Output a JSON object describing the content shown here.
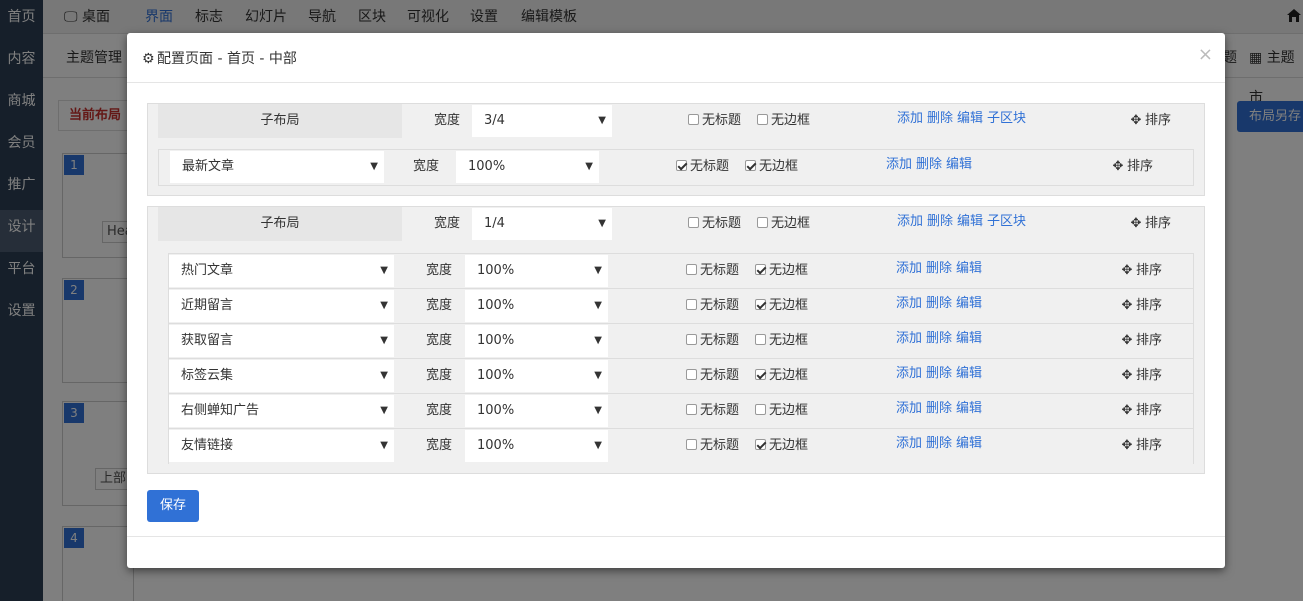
{
  "sidebar": {
    "items": [
      "首页",
      "内容",
      "商城",
      "会员",
      "推广",
      "设计",
      "平台",
      "设置"
    ],
    "active": "设计"
  },
  "topnav": {
    "desktop": "桌面",
    "items": [
      "界面",
      "标志",
      "幻灯片",
      "导航",
      "区块",
      "可视化",
      "设置",
      "编辑模板"
    ],
    "active": "界面"
  },
  "subnav": {
    "left": "主题管理",
    "right_1": "题",
    "right_2": "主题市"
  },
  "background": {
    "current_layout": "当前布局",
    "save_as": "布局另存",
    "blocks": [
      {
        "num": "1",
        "tag": "Hea"
      },
      {
        "num": "2",
        "tag": ""
      },
      {
        "num": "3",
        "tag": "上部"
      },
      {
        "num": "4",
        "tag": ""
      }
    ]
  },
  "modal": {
    "title": "配置页面 - 首页 - 中部",
    "close": "×",
    "save": "保存",
    "labels": {
      "sublayout": "子布局",
      "width": "宽度",
      "no_title": "无标题",
      "no_border": "无边框",
      "add": "添加",
      "delete": "删除",
      "edit": "编辑",
      "sub_block": "子区块",
      "sort": "排序"
    },
    "layouts": [
      {
        "width": "3/4",
        "no_title": false,
        "no_border": false,
        "blocks": [
          {
            "name": "最新文章",
            "width": "100%",
            "no_title": true,
            "no_border": true
          }
        ]
      },
      {
        "width": "1/4",
        "no_title": false,
        "no_border": false,
        "blocks": [
          {
            "name": "热门文章",
            "width": "100%",
            "no_title": false,
            "no_border": true
          },
          {
            "name": "近期留言",
            "width": "100%",
            "no_title": false,
            "no_border": true
          },
          {
            "name": "获取留言",
            "width": "100%",
            "no_title": false,
            "no_border": false
          },
          {
            "name": "标签云集",
            "width": "100%",
            "no_title": false,
            "no_border": true
          },
          {
            "name": "右侧蝉知广告",
            "width": "100%",
            "no_title": false,
            "no_border": false
          },
          {
            "name": "友情链接",
            "width": "100%",
            "no_title": false,
            "no_border": true
          }
        ]
      }
    ]
  },
  "colors": {
    "accent": "#3071d6",
    "sidebar": "#2d3f55",
    "danger": "#c9302c"
  }
}
